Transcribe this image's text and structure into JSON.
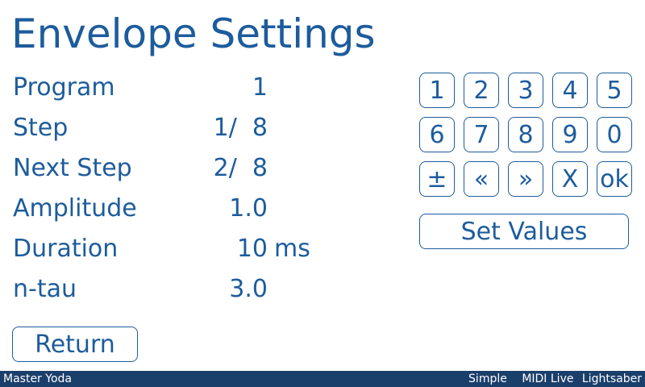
{
  "title": "Envelope Settings",
  "params": [
    {
      "label": "Program",
      "value": "1",
      "unit": ""
    },
    {
      "label": "Step",
      "value": "1/  8",
      "unit": ""
    },
    {
      "label": "Next Step",
      "value": "2/  8",
      "unit": ""
    },
    {
      "label": "Amplitude",
      "value": "1.0",
      "unit": ""
    },
    {
      "label": "Duration",
      "value": "10",
      "unit": "ms"
    },
    {
      "label": "n-tau",
      "value": "3.0",
      "unit": ""
    }
  ],
  "keypad": [
    [
      "1",
      "2",
      "3",
      "4",
      "5"
    ],
    [
      "6",
      "7",
      "8",
      "9",
      "0"
    ],
    [
      "±",
      "«",
      "»",
      "X",
      "ok"
    ]
  ],
  "buttons": {
    "set_values": "Set Values",
    "return": "Return"
  },
  "statusbar": {
    "user": "Master Yoda",
    "mode": "Simple",
    "midi": "MIDI Live",
    "preset": "Lightsaber"
  }
}
